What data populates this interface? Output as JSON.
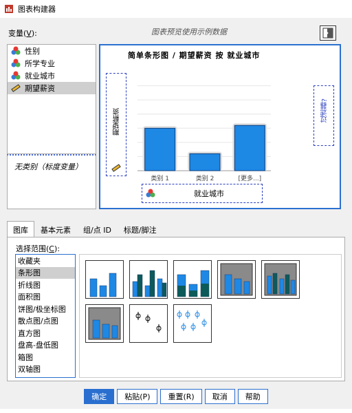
{
  "window": {
    "title": "图表构建器"
  },
  "variables_label": {
    "text": "变量(",
    "key": "V",
    "suffix": "):"
  },
  "preview_note": "图表预览使用示例数据",
  "variables": [
    {
      "label": "性别",
      "icon": "nominal-icon",
      "selected": false
    },
    {
      "label": "所学专业",
      "icon": "nominal-icon",
      "selected": false
    },
    {
      "label": "就业城市",
      "icon": "nominal-icon",
      "selected": false
    },
    {
      "label": "期望薪资",
      "icon": "scale-icon",
      "selected": true
    }
  ],
  "no_category": "无类别（标度变量）",
  "canvas": {
    "title": "简单条形图 / 期望薪资 按 就业城市",
    "y_drop": "期望薪资",
    "filter": "过滤器?",
    "x_drop": "就业城市"
  },
  "chart_data": {
    "type": "bar",
    "categories": [
      "类别 1",
      "类别 2",
      "[更多...]"
    ],
    "values": [
      3,
      1.2,
      3.2
    ],
    "title": "简单条形图 / 期望薪资 按 就业城市",
    "xlabel": "就业城市",
    "ylabel": "期望薪资",
    "ylim": [
      0,
      7
    ]
  },
  "tabs": [
    "图库",
    "基本元素",
    "组/点 ID",
    "标题/脚注"
  ],
  "choose_from": {
    "text": "选择范围(",
    "key": "C",
    "suffix": "):"
  },
  "gallery_types": [
    "收藏夹",
    "条形图",
    "折线图",
    "面积图",
    "饼图/极坐标图",
    "散点图/点图",
    "直方图",
    "盘高-盘低图",
    "箱图",
    "双轴图"
  ],
  "gallery_selected": 1,
  "buttons": {
    "ok": "确定",
    "paste": "粘贴(P)",
    "reset": "重置(R)",
    "cancel": "取消",
    "help": "帮助"
  },
  "colors": {
    "accent": "#2a6fcf",
    "bar": "#1e88e5",
    "bar_dark": "#0d5a5a"
  }
}
